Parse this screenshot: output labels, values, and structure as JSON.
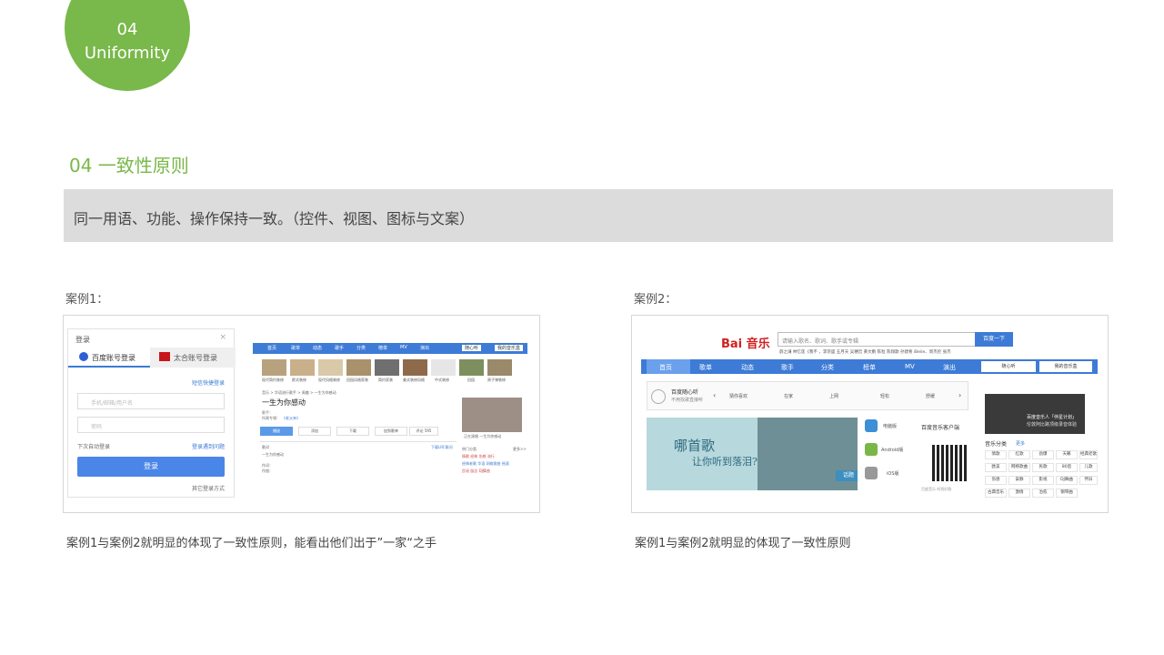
{
  "badge": {
    "number": "04",
    "word": "Uniformity"
  },
  "section": {
    "title": "04 一致性原则",
    "summary": "同一用语、功能、操作保持一致。（控件、视图、图标与文案）"
  },
  "case1": {
    "label": "案例1：",
    "caption": "案例1与案例2就明显的体现了一致性原则，能看出他们出于”一家“之手",
    "login": {
      "header": "登录",
      "close": "×",
      "tab_baidu": "百度账号登录",
      "tab_taihe": "太合账号登录",
      "quick": "短信快捷登录",
      "username_placeholder": "手机/邮箱/用户名",
      "password_placeholder": "密码",
      "remember": "下次自动登录",
      "forgot": "登录遇到问题",
      "submit": "登录",
      "other": "其它登录方式"
    },
    "mini": {
      "nav": [
        "首页",
        "歌单",
        "动态",
        "歌手",
        "分类",
        "榜单",
        "MV",
        "演出"
      ],
      "nav_right": [
        "随心听",
        "我的音乐盒"
      ],
      "thumbs": [
        "现代简约装修",
        "欧式装修",
        "现代风格装修",
        "田园风格家装",
        "简约家装",
        "美式装修风格",
        "中式装修",
        "田园",
        "原子弹装修"
      ],
      "breadcrumb": "音乐 > 华语流行歌手 > 周傲 > 一生为你感动",
      "song": "一生为你感动",
      "singer": "歌手：",
      "album": "所属专辑：",
      "album_name": "《老父亲》",
      "actions": [
        "播放",
        "添加",
        "下载",
        "加到歌单",
        "评论 595"
      ],
      "lyrics_label": "歌词",
      "lyrics_more": "下载LRC歌词",
      "lyric_line": "一生为你感动",
      "composer": "作词：",
      "writer": "作曲：",
      "right_caption": "正在演唱 一生为你感动",
      "right_hot": "热门分类",
      "right_more": "更多>>",
      "right_tags": [
        "情歌",
        "经典",
        "伤感",
        "流行",
        "经典老歌",
        "华语",
        "网络歌曲",
        "摇滚",
        "民谣",
        "励志",
        "DJ舞曲"
      ]
    }
  },
  "case2": {
    "label": "案例2：",
    "caption": "案例1与案例2就明显的体现了一致性原则",
    "logo": "Bai 音乐",
    "search_placeholder": "请输入歌名、歌词、歌手或专辑",
    "search_button": "百度一下",
    "hot_searches": "薛之谦  林忆莲《我不 ，李宗盛  五月天  吴穗哲  黄文鹏  陈粒  陈翔歌  孙建希  iBeile、周杰伦  张杰",
    "nav": [
      "首页",
      "歌单",
      "动态",
      "歌手",
      "分类",
      "榜单",
      "MV",
      "演出"
    ],
    "nav_right": [
      "随心听",
      "我的音乐盒"
    ],
    "radio_title": "百度随心听",
    "radio_sub": "不用找歌直接听",
    "quick": [
      "猜你喜欢",
      "在家",
      "上网",
      "轻松",
      "舒缓"
    ],
    "banner_line1": "哪首歌",
    "banner_line2": "让你听到落泪?",
    "banner_tag": "话题",
    "clients": [
      "电脑版",
      "Android版",
      "iOS版"
    ],
    "client_title": "百度音乐客户端",
    "qr_caption": "百度音乐 听到好歌",
    "studio_title": "百度音乐人「伴星计划」",
    "studio_sub": "伦敦阿比路顶级录音体验",
    "category_title": "音乐分类",
    "category_more": "更多",
    "categories": [
      "情歌",
      "红歌",
      "劲爆",
      "天籁",
      "经典老歌",
      "欧美",
      "网络歌曲",
      "民歌",
      "80后",
      "儿歌",
      "伤感",
      "安静",
      "影视",
      "DJ舞曲",
      "怀旧",
      "古典音乐",
      "激情",
      "治愈",
      "钢琴曲"
    ]
  }
}
